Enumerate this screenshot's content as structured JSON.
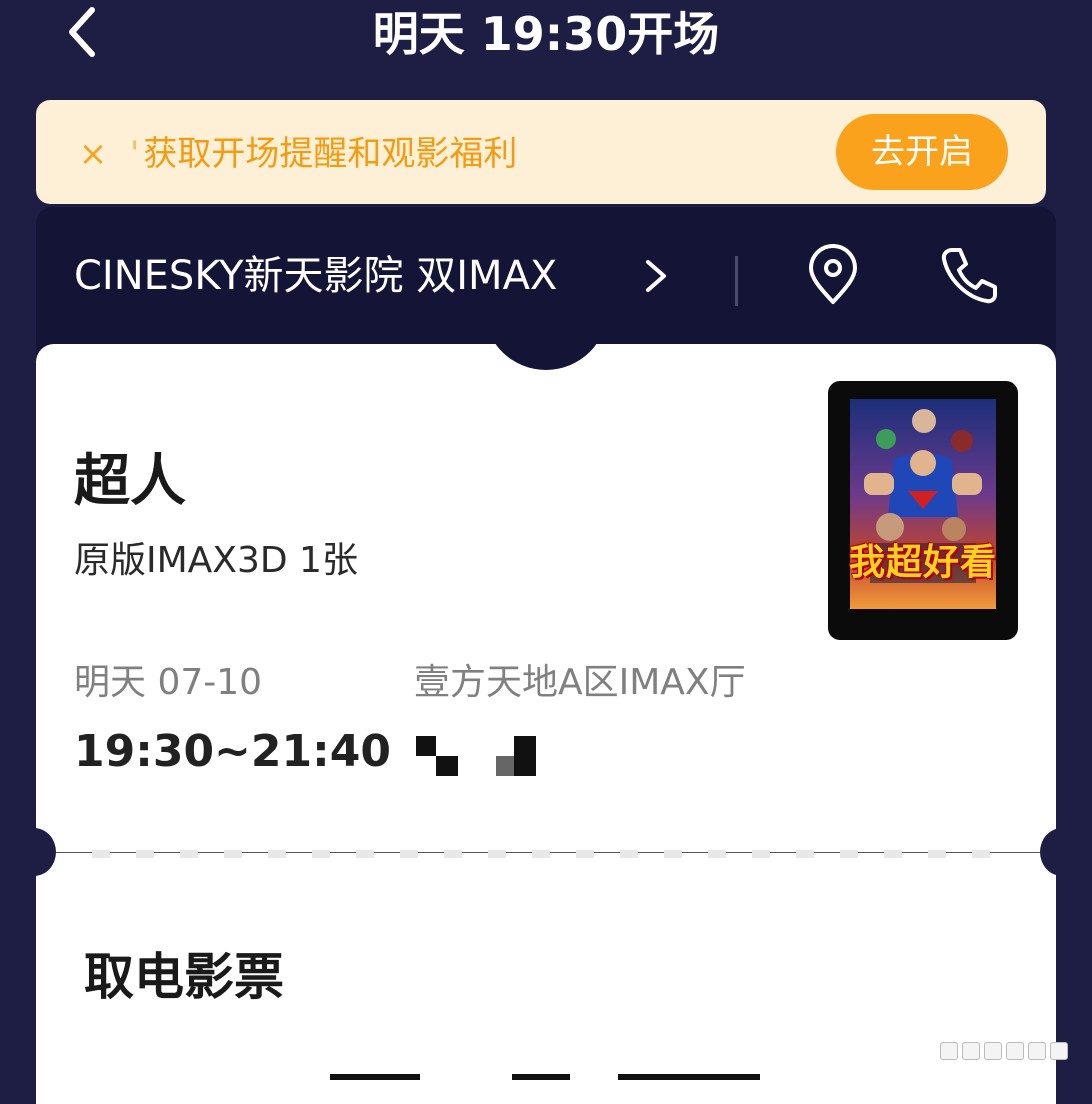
{
  "header": {
    "title": "明天 19:30开场",
    "back_icon": "chevron-left-icon"
  },
  "banner": {
    "close_symbol": "×",
    "tick": "'",
    "text": "获取开场提醒和观影福利",
    "button_label": "去开启",
    "colors": {
      "background": "#fdf0d7",
      "text": "#f39c12",
      "button": "#fba21c"
    }
  },
  "cinema": {
    "name": "CINESKY新天影院 双IMAX",
    "chevron_icon": "chevron-right-icon",
    "location_icon": "map-pin-icon",
    "phone_icon": "phone-icon"
  },
  "movie": {
    "title": "超人",
    "format": "原版IMAX3D 1张",
    "date": "明天 07-10",
    "time": "19:30~21:40",
    "hall": "壹方天地A区IMAX厅",
    "poster_caption": "我超好看"
  },
  "pickup": {
    "title": "取电影票"
  },
  "colors": {
    "page_background": "#1e1d44",
    "panel_dark": "#141436",
    "card": "#ffffff"
  }
}
